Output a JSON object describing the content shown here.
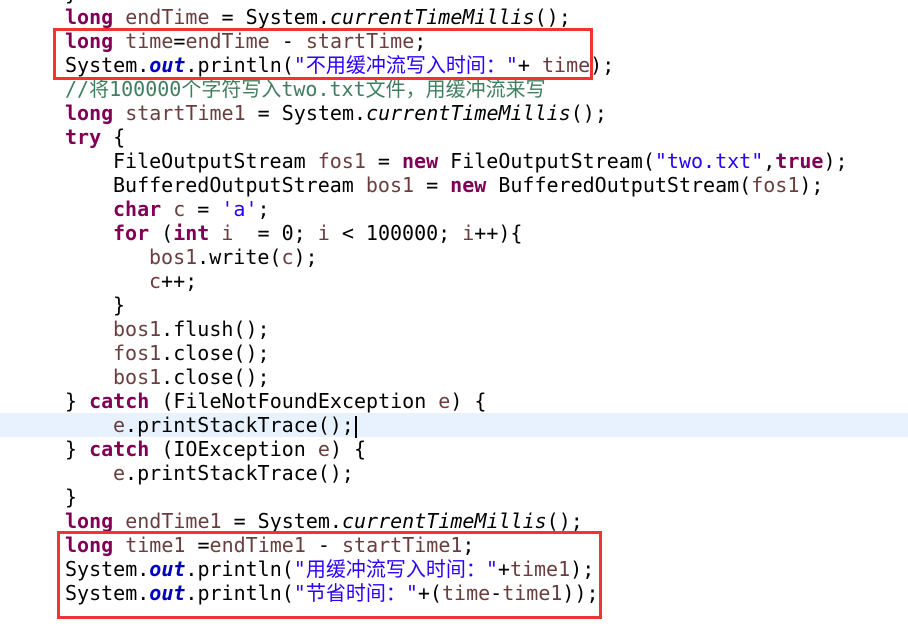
{
  "editor": {
    "highlight_color": "#e8f2fe",
    "annotation_color": "#f03434",
    "current_line": 18,
    "lines": [
      {
        "indent": 0,
        "tokens": [
          [
            "p",
            "}"
          ]
        ]
      },
      {
        "indent": 0,
        "tokens": [
          [
            "k",
            "long"
          ],
          [
            "p",
            " "
          ],
          [
            "v",
            "endTime"
          ],
          [
            "p",
            " = System."
          ],
          [
            "m",
            "currentTimeMillis"
          ],
          [
            "p",
            "();"
          ]
        ]
      },
      {
        "indent": 0,
        "tokens": [
          [
            "k",
            "long"
          ],
          [
            "p",
            " "
          ],
          [
            "v",
            "time"
          ],
          [
            "p",
            "="
          ],
          [
            "v",
            "endTime"
          ],
          [
            "p",
            " - "
          ],
          [
            "v",
            "startTime"
          ],
          [
            "p",
            ";"
          ]
        ]
      },
      {
        "indent": 0,
        "tokens": [
          [
            "p",
            "System."
          ],
          [
            "f",
            "out"
          ],
          [
            "p",
            ".println("
          ],
          [
            "s",
            "\"不用缓冲流写入时间：\""
          ],
          [
            "p",
            "+ "
          ],
          [
            "v",
            "time"
          ],
          [
            "p",
            ");"
          ]
        ]
      },
      {
        "indent": 0,
        "tokens": [
          [
            "c",
            "//将100000个字符写入two.txt文件，用缓冲流来写"
          ]
        ]
      },
      {
        "indent": 0,
        "tokens": [
          [
            "k",
            "long"
          ],
          [
            "p",
            " "
          ],
          [
            "v",
            "startTime1"
          ],
          [
            "p",
            " = System."
          ],
          [
            "m",
            "currentTimeMillis"
          ],
          [
            "p",
            "();"
          ]
        ]
      },
      {
        "indent": 0,
        "tokens": [
          [
            "k",
            "try"
          ],
          [
            "p",
            " {"
          ]
        ]
      },
      {
        "indent": 4,
        "tokens": [
          [
            "p",
            "FileOutputStream "
          ],
          [
            "v",
            "fos1"
          ],
          [
            "p",
            " = "
          ],
          [
            "k",
            "new"
          ],
          [
            "p",
            " FileOutputStream("
          ],
          [
            "s",
            "\"two.txt\""
          ],
          [
            "p",
            ","
          ],
          [
            "k",
            "true"
          ],
          [
            "p",
            ");"
          ]
        ]
      },
      {
        "indent": 4,
        "tokens": [
          [
            "p",
            "BufferedOutputStream "
          ],
          [
            "v",
            "bos1"
          ],
          [
            "p",
            " = "
          ],
          [
            "k",
            "new"
          ],
          [
            "p",
            " BufferedOutputStream("
          ],
          [
            "v",
            "fos1"
          ],
          [
            "p",
            ");"
          ]
        ]
      },
      {
        "indent": 4,
        "tokens": [
          [
            "k",
            "char"
          ],
          [
            "p",
            " "
          ],
          [
            "v",
            "c"
          ],
          [
            "p",
            " = "
          ],
          [
            "s",
            "'a'"
          ],
          [
            "p",
            ";"
          ]
        ]
      },
      {
        "indent": 4,
        "tokens": [
          [
            "k",
            "for"
          ],
          [
            "p",
            " ("
          ],
          [
            "k",
            "int"
          ],
          [
            "p",
            " "
          ],
          [
            "v",
            "i"
          ],
          [
            "p",
            "  = 0; "
          ],
          [
            "v",
            "i"
          ],
          [
            "p",
            " < 100000; "
          ],
          [
            "v",
            "i"
          ],
          [
            "p",
            "++){"
          ]
        ]
      },
      {
        "indent": 7,
        "tokens": [
          [
            "v",
            "bos1"
          ],
          [
            "p",
            ".write("
          ],
          [
            "v",
            "c"
          ],
          [
            "p",
            ");"
          ]
        ]
      },
      {
        "indent": 7,
        "tokens": [
          [
            "v",
            "c"
          ],
          [
            "p",
            "++;"
          ]
        ]
      },
      {
        "indent": 4,
        "tokens": [
          [
            "p",
            "}"
          ]
        ]
      },
      {
        "indent": 4,
        "tokens": [
          [
            "v",
            "bos1"
          ],
          [
            "p",
            ".flush();"
          ]
        ]
      },
      {
        "indent": 4,
        "tokens": [
          [
            "v",
            "fos1"
          ],
          [
            "p",
            ".close();"
          ]
        ]
      },
      {
        "indent": 4,
        "tokens": [
          [
            "v",
            "bos1"
          ],
          [
            "p",
            ".close();"
          ]
        ]
      },
      {
        "indent": 0,
        "tokens": [
          [
            "p",
            "} "
          ],
          [
            "k",
            "catch"
          ],
          [
            "p",
            " (FileNotFoundException "
          ],
          [
            "v",
            "e"
          ],
          [
            "p",
            ") {"
          ]
        ]
      },
      {
        "indent": 4,
        "tokens": [
          [
            "v",
            "e"
          ],
          [
            "p",
            ".printStackTrace();"
          ]
        ]
      },
      {
        "indent": 0,
        "tokens": [
          [
            "p",
            "} "
          ],
          [
            "k",
            "catch"
          ],
          [
            "p",
            " (IOException "
          ],
          [
            "v",
            "e"
          ],
          [
            "p",
            ") {"
          ]
        ]
      },
      {
        "indent": 4,
        "tokens": [
          [
            "v",
            "e"
          ],
          [
            "p",
            ".printStackTrace();"
          ]
        ]
      },
      {
        "indent": 0,
        "tokens": [
          [
            "p",
            "}"
          ]
        ]
      },
      {
        "indent": 0,
        "tokens": [
          [
            "k",
            "long"
          ],
          [
            "p",
            " "
          ],
          [
            "v",
            "endTime1"
          ],
          [
            "p",
            " = System."
          ],
          [
            "m",
            "currentTimeMillis"
          ],
          [
            "p",
            "();"
          ]
        ]
      },
      {
        "indent": 0,
        "tokens": [
          [
            "k",
            "long"
          ],
          [
            "p",
            " "
          ],
          [
            "v",
            "time1"
          ],
          [
            "p",
            " ="
          ],
          [
            "v",
            "endTime1"
          ],
          [
            "p",
            " - "
          ],
          [
            "v",
            "startTime1"
          ],
          [
            "p",
            ";"
          ]
        ]
      },
      {
        "indent": 0,
        "tokens": [
          [
            "p",
            "System."
          ],
          [
            "f",
            "out"
          ],
          [
            "p",
            ".println("
          ],
          [
            "s",
            "\"用缓冲流写入时间：\""
          ],
          [
            "p",
            "+"
          ],
          [
            "v",
            "time1"
          ],
          [
            "p",
            ");"
          ]
        ]
      },
      {
        "indent": 0,
        "tokens": [
          [
            "p",
            "System."
          ],
          [
            "f",
            "out"
          ],
          [
            "p",
            ".println("
          ],
          [
            "s",
            "\"节省时间：\""
          ],
          [
            "p",
            "+("
          ],
          [
            "v",
            "time"
          ],
          [
            "p",
            "-"
          ],
          [
            "v",
            "time1"
          ],
          [
            "p",
            "));"
          ]
        ]
      }
    ]
  }
}
